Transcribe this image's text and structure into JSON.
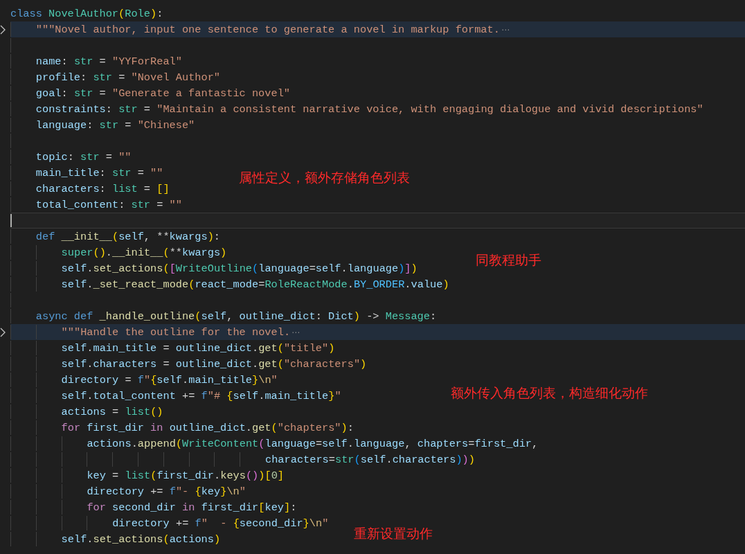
{
  "editor": {
    "lines": [
      {
        "tokens": [
          {
            "kind": "kw",
            "text": "class "
          },
          {
            "kind": "cls",
            "text": "NovelAuthor"
          },
          {
            "kind": "b1",
            "text": "("
          },
          {
            "kind": "cls",
            "text": "Role"
          },
          {
            "kind": "b1",
            "text": ")"
          },
          {
            "kind": "op",
            "text": ":"
          }
        ],
        "children": [
          {
            "folded": true,
            "fold_marker": "⋯",
            "tokens": [
              {
                "kind": "str",
                "text": "\"\"\"Novel author, input one sentence to generate a novel in markup format."
              }
            ]
          },
          {
            "current": false
          },
          {
            "tokens": [
              {
                "kind": "var",
                "text": "name"
              },
              {
                "kind": "op",
                "text": ": "
              },
              {
                "kind": "cls",
                "text": "str"
              },
              {
                "kind": "op",
                "text": " = "
              },
              {
                "kind": "str",
                "text": "\"YYForReal\""
              }
            ]
          },
          {
            "tokens": [
              {
                "kind": "var",
                "text": "profile"
              },
              {
                "kind": "op",
                "text": ": "
              },
              {
                "kind": "cls",
                "text": "str"
              },
              {
                "kind": "op",
                "text": " = "
              },
              {
                "kind": "str",
                "text": "\"Novel Author\""
              }
            ]
          },
          {
            "tokens": [
              {
                "kind": "var",
                "text": "goal"
              },
              {
                "kind": "op",
                "text": ": "
              },
              {
                "kind": "cls",
                "text": "str"
              },
              {
                "kind": "op",
                "text": " = "
              },
              {
                "kind": "str",
                "text": "\"Generate a fantastic novel\""
              }
            ]
          },
          {
            "tokens": [
              {
                "kind": "var",
                "text": "constraints"
              },
              {
                "kind": "op",
                "text": ": "
              },
              {
                "kind": "cls",
                "text": "str"
              },
              {
                "kind": "op",
                "text": " = "
              },
              {
                "kind": "str",
                "text": "\"Maintain a consistent narrative voice, with engaging dialogue and vivid descriptions\""
              }
            ]
          },
          {
            "tokens": [
              {
                "kind": "var",
                "text": "language"
              },
              {
                "kind": "op",
                "text": ": "
              },
              {
                "kind": "cls",
                "text": "str"
              },
              {
                "kind": "op",
                "text": " = "
              },
              {
                "kind": "str",
                "text": "\"Chinese\""
              }
            ]
          },
          {
            "current": false
          },
          {
            "tokens": [
              {
                "kind": "var",
                "text": "topic"
              },
              {
                "kind": "op",
                "text": ": "
              },
              {
                "kind": "cls",
                "text": "str"
              },
              {
                "kind": "op",
                "text": " = "
              },
              {
                "kind": "str",
                "text": "\"\""
              }
            ]
          },
          {
            "tokens": [
              {
                "kind": "var",
                "text": "main_title"
              },
              {
                "kind": "op",
                "text": ": "
              },
              {
                "kind": "cls",
                "text": "str"
              },
              {
                "kind": "op",
                "text": " = "
              },
              {
                "kind": "str",
                "text": "\"\""
              }
            ]
          },
          {
            "tokens": [
              {
                "kind": "var",
                "text": "characters"
              },
              {
                "kind": "op",
                "text": ": "
              },
              {
                "kind": "cls",
                "text": "list"
              },
              {
                "kind": "op",
                "text": " = "
              },
              {
                "kind": "b1",
                "text": "[]"
              }
            ]
          },
          {
            "tokens": [
              {
                "kind": "var",
                "text": "total_content"
              },
              {
                "kind": "op",
                "text": ": "
              },
              {
                "kind": "cls",
                "text": "str"
              },
              {
                "kind": "op",
                "text": " = "
              },
              {
                "kind": "str",
                "text": "\"\""
              }
            ]
          },
          {
            "current": true
          },
          {
            "tokens": [
              {
                "kind": "kw",
                "text": "def "
              },
              {
                "kind": "fn",
                "text": "__init__"
              },
              {
                "kind": "b1",
                "text": "("
              },
              {
                "kind": "var",
                "text": "self"
              },
              {
                "kind": "op",
                "text": ", **"
              },
              {
                "kind": "var",
                "text": "kwargs"
              },
              {
                "kind": "b1",
                "text": ")"
              },
              {
                "kind": "op",
                "text": ":"
              }
            ],
            "children": [
              {
                "tokens": [
                  {
                    "kind": "cls",
                    "text": "super"
                  },
                  {
                    "kind": "b1",
                    "text": "()"
                  },
                  {
                    "kind": "op",
                    "text": "."
                  },
                  {
                    "kind": "fn",
                    "text": "__init__"
                  },
                  {
                    "kind": "b1",
                    "text": "("
                  },
                  {
                    "kind": "op",
                    "text": "**"
                  },
                  {
                    "kind": "var",
                    "text": "kwargs"
                  },
                  {
                    "kind": "b1",
                    "text": ")"
                  }
                ]
              },
              {
                "tokens": [
                  {
                    "kind": "var",
                    "text": "self"
                  },
                  {
                    "kind": "op",
                    "text": "."
                  },
                  {
                    "kind": "fn",
                    "text": "set_actions"
                  },
                  {
                    "kind": "b1",
                    "text": "("
                  },
                  {
                    "kind": "b2",
                    "text": "["
                  },
                  {
                    "kind": "cls",
                    "text": "WriteOutline"
                  },
                  {
                    "kind": "b3",
                    "text": "("
                  },
                  {
                    "kind": "var",
                    "text": "language"
                  },
                  {
                    "kind": "op",
                    "text": "="
                  },
                  {
                    "kind": "var",
                    "text": "self"
                  },
                  {
                    "kind": "op",
                    "text": "."
                  },
                  {
                    "kind": "var",
                    "text": "language"
                  },
                  {
                    "kind": "b3",
                    "text": ")"
                  },
                  {
                    "kind": "b2",
                    "text": "]"
                  },
                  {
                    "kind": "b1",
                    "text": ")"
                  }
                ]
              },
              {
                "tokens": [
                  {
                    "kind": "var",
                    "text": "self"
                  },
                  {
                    "kind": "op",
                    "text": "."
                  },
                  {
                    "kind": "fn",
                    "text": "_set_react_mode"
                  },
                  {
                    "kind": "b1",
                    "text": "("
                  },
                  {
                    "kind": "var",
                    "text": "react_mode"
                  },
                  {
                    "kind": "op",
                    "text": "="
                  },
                  {
                    "kind": "cls",
                    "text": "RoleReactMode"
                  },
                  {
                    "kind": "op",
                    "text": "."
                  },
                  {
                    "kind": "const",
                    "text": "BY_ORDER"
                  },
                  {
                    "kind": "op",
                    "text": "."
                  },
                  {
                    "kind": "var",
                    "text": "value"
                  },
                  {
                    "kind": "b1",
                    "text": ")"
                  }
                ]
              }
            ]
          },
          {
            "current": false
          },
          {
            "tokens": [
              {
                "kind": "kw",
                "text": "async def "
              },
              {
                "kind": "fn",
                "text": "_handle_outline"
              },
              {
                "kind": "b1",
                "text": "("
              },
              {
                "kind": "var",
                "text": "self"
              },
              {
                "kind": "op",
                "text": ", "
              },
              {
                "kind": "var",
                "text": "outline_dict"
              },
              {
                "kind": "op",
                "text": ": "
              },
              {
                "kind": "var",
                "text": "Dict"
              },
              {
                "kind": "b1",
                "text": ")"
              },
              {
                "kind": "op",
                "text": " -> "
              },
              {
                "kind": "cls",
                "text": "Message"
              },
              {
                "kind": "op",
                "text": ":"
              }
            ],
            "children": [
              {
                "folded": true,
                "fold_marker": "⋯",
                "tokens": [
                  {
                    "kind": "str",
                    "text": "\"\"\"Handle the outline for the novel."
                  }
                ]
              },
              {
                "tokens": [
                  {
                    "kind": "var",
                    "text": "self"
                  },
                  {
                    "kind": "op",
                    "text": "."
                  },
                  {
                    "kind": "var",
                    "text": "main_title"
                  },
                  {
                    "kind": "op",
                    "text": " = "
                  },
                  {
                    "kind": "var",
                    "text": "outline_dict"
                  },
                  {
                    "kind": "op",
                    "text": "."
                  },
                  {
                    "kind": "fn",
                    "text": "get"
                  },
                  {
                    "kind": "b1",
                    "text": "("
                  },
                  {
                    "kind": "str",
                    "text": "\"title\""
                  },
                  {
                    "kind": "b1",
                    "text": ")"
                  }
                ]
              },
              {
                "tokens": [
                  {
                    "kind": "var",
                    "text": "self"
                  },
                  {
                    "kind": "op",
                    "text": "."
                  },
                  {
                    "kind": "var",
                    "text": "characters"
                  },
                  {
                    "kind": "op",
                    "text": " = "
                  },
                  {
                    "kind": "var",
                    "text": "outline_dict"
                  },
                  {
                    "kind": "op",
                    "text": "."
                  },
                  {
                    "kind": "fn",
                    "text": "get"
                  },
                  {
                    "kind": "b1",
                    "text": "("
                  },
                  {
                    "kind": "str",
                    "text": "\"characters\""
                  },
                  {
                    "kind": "b1",
                    "text": ")"
                  }
                ]
              },
              {
                "tokens": [
                  {
                    "kind": "var",
                    "text": "directory"
                  },
                  {
                    "kind": "op",
                    "text": " = "
                  },
                  {
                    "kind": "kw",
                    "text": "f"
                  },
                  {
                    "kind": "str",
                    "text": "\""
                  },
                  {
                    "kind": "b1",
                    "text": "{"
                  },
                  {
                    "kind": "var",
                    "text": "self"
                  },
                  {
                    "kind": "op",
                    "text": "."
                  },
                  {
                    "kind": "var",
                    "text": "main_title"
                  },
                  {
                    "kind": "b1",
                    "text": "}"
                  },
                  {
                    "kind": "esc",
                    "text": "\\n"
                  },
                  {
                    "kind": "str",
                    "text": "\""
                  }
                ]
              },
              {
                "tokens": [
                  {
                    "kind": "var",
                    "text": "self"
                  },
                  {
                    "kind": "op",
                    "text": "."
                  },
                  {
                    "kind": "var",
                    "text": "total_content"
                  },
                  {
                    "kind": "op",
                    "text": " += "
                  },
                  {
                    "kind": "kw",
                    "text": "f"
                  },
                  {
                    "kind": "str",
                    "text": "\"# "
                  },
                  {
                    "kind": "b1",
                    "text": "{"
                  },
                  {
                    "kind": "var",
                    "text": "self"
                  },
                  {
                    "kind": "op",
                    "text": "."
                  },
                  {
                    "kind": "var",
                    "text": "main_title"
                  },
                  {
                    "kind": "b1",
                    "text": "}"
                  },
                  {
                    "kind": "str",
                    "text": "\""
                  }
                ]
              },
              {
                "tokens": [
                  {
                    "kind": "var",
                    "text": "actions"
                  },
                  {
                    "kind": "op",
                    "text": " = "
                  },
                  {
                    "kind": "cls",
                    "text": "list"
                  },
                  {
                    "kind": "b1",
                    "text": "()"
                  }
                ]
              },
              {
                "tokens": [
                  {
                    "kind": "ctl",
                    "text": "for "
                  },
                  {
                    "kind": "var",
                    "text": "first_dir "
                  },
                  {
                    "kind": "ctl",
                    "text": "in "
                  },
                  {
                    "kind": "var",
                    "text": "outline_dict"
                  },
                  {
                    "kind": "op",
                    "text": "."
                  },
                  {
                    "kind": "fn",
                    "text": "get"
                  },
                  {
                    "kind": "b1",
                    "text": "("
                  },
                  {
                    "kind": "str",
                    "text": "\"chapters\""
                  },
                  {
                    "kind": "b1",
                    "text": ")"
                  },
                  {
                    "kind": "op",
                    "text": ":"
                  }
                ],
                "children": [
                  {
                    "tokens": [
                      {
                        "kind": "var",
                        "text": "actions"
                      },
                      {
                        "kind": "op",
                        "text": "."
                      },
                      {
                        "kind": "fn",
                        "text": "append"
                      },
                      {
                        "kind": "b1",
                        "text": "("
                      },
                      {
                        "kind": "cls",
                        "text": "WriteContent"
                      },
                      {
                        "kind": "b2",
                        "text": "("
                      },
                      {
                        "kind": "var",
                        "text": "language"
                      },
                      {
                        "kind": "op",
                        "text": "="
                      },
                      {
                        "kind": "var",
                        "text": "self"
                      },
                      {
                        "kind": "op",
                        "text": "."
                      },
                      {
                        "kind": "var",
                        "text": "language"
                      },
                      {
                        "kind": "op",
                        "text": ", "
                      },
                      {
                        "kind": "var",
                        "text": "chapters"
                      },
                      {
                        "kind": "op",
                        "text": "="
                      },
                      {
                        "kind": "var",
                        "text": "first_dir"
                      },
                      {
                        "kind": "op",
                        "text": ","
                      }
                    ],
                    "continuation": [
                      {
                        "kind": "var",
                        "text": "characters"
                      },
                      {
                        "kind": "op",
                        "text": "="
                      },
                      {
                        "kind": "cls",
                        "text": "str"
                      },
                      {
                        "kind": "b3",
                        "text": "("
                      },
                      {
                        "kind": "var",
                        "text": "self"
                      },
                      {
                        "kind": "op",
                        "text": "."
                      },
                      {
                        "kind": "var",
                        "text": "characters"
                      },
                      {
                        "kind": "b3",
                        "text": ")"
                      },
                      {
                        "kind": "b2",
                        "text": ")"
                      },
                      {
                        "kind": "b1",
                        "text": ")"
                      }
                    ]
                  },
                  {
                    "tokens": [
                      {
                        "kind": "var",
                        "text": "key"
                      },
                      {
                        "kind": "op",
                        "text": " = "
                      },
                      {
                        "kind": "cls",
                        "text": "list"
                      },
                      {
                        "kind": "b1",
                        "text": "("
                      },
                      {
                        "kind": "var",
                        "text": "first_dir"
                      },
                      {
                        "kind": "op",
                        "text": "."
                      },
                      {
                        "kind": "fn",
                        "text": "keys"
                      },
                      {
                        "kind": "b2",
                        "text": "()"
                      },
                      {
                        "kind": "b1",
                        "text": ")"
                      },
                      {
                        "kind": "b1",
                        "text": "["
                      },
                      {
                        "kind": "num",
                        "text": "0"
                      },
                      {
                        "kind": "b1",
                        "text": "]"
                      }
                    ]
                  },
                  {
                    "tokens": [
                      {
                        "kind": "var",
                        "text": "directory"
                      },
                      {
                        "kind": "op",
                        "text": " += "
                      },
                      {
                        "kind": "kw",
                        "text": "f"
                      },
                      {
                        "kind": "str",
                        "text": "\"- "
                      },
                      {
                        "kind": "b1",
                        "text": "{"
                      },
                      {
                        "kind": "var",
                        "text": "key"
                      },
                      {
                        "kind": "b1",
                        "text": "}"
                      },
                      {
                        "kind": "esc",
                        "text": "\\n"
                      },
                      {
                        "kind": "str",
                        "text": "\""
                      }
                    ]
                  },
                  {
                    "tokens": [
                      {
                        "kind": "ctl",
                        "text": "for "
                      },
                      {
                        "kind": "var",
                        "text": "second_dir "
                      },
                      {
                        "kind": "ctl",
                        "text": "in "
                      },
                      {
                        "kind": "var",
                        "text": "first_dir"
                      },
                      {
                        "kind": "b1",
                        "text": "["
                      },
                      {
                        "kind": "var",
                        "text": "key"
                      },
                      {
                        "kind": "b1",
                        "text": "]"
                      },
                      {
                        "kind": "op",
                        "text": ":"
                      }
                    ],
                    "children": [
                      {
                        "tokens": [
                          {
                            "kind": "var",
                            "text": "directory"
                          },
                          {
                            "kind": "op",
                            "text": " += "
                          },
                          {
                            "kind": "kw",
                            "text": "f"
                          },
                          {
                            "kind": "str",
                            "text": "\"  - "
                          },
                          {
                            "kind": "b1",
                            "text": "{"
                          },
                          {
                            "kind": "var",
                            "text": "second_dir"
                          },
                          {
                            "kind": "b1",
                            "text": "}"
                          },
                          {
                            "kind": "esc",
                            "text": "\\n"
                          },
                          {
                            "kind": "str",
                            "text": "\""
                          }
                        ]
                      }
                    ]
                  }
                ]
              },
              {
                "tokens": [
                  {
                    "kind": "var",
                    "text": "self"
                  },
                  {
                    "kind": "op",
                    "text": "."
                  },
                  {
                    "kind": "fn",
                    "text": "set_actions"
                  },
                  {
                    "kind": "b1",
                    "text": "("
                  },
                  {
                    "kind": "var",
                    "text": "actions"
                  },
                  {
                    "kind": "b1",
                    "text": ")"
                  }
                ]
              }
            ]
          }
        ]
      }
    ]
  },
  "annotations": [
    {
      "text": "属性定义，额外存储角色列表"
    },
    {
      "text": "同教程助手"
    },
    {
      "text": "额外传入角色列表，构造细化动作"
    },
    {
      "text": "重新设置动作"
    }
  ]
}
